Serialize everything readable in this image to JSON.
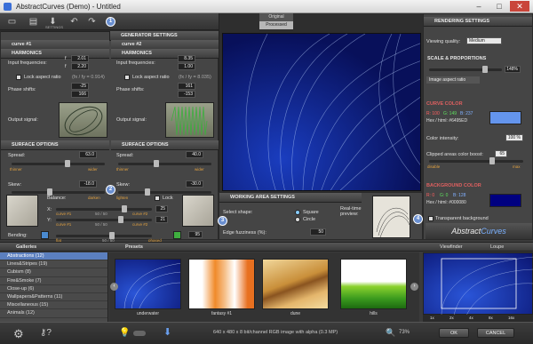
{
  "window": {
    "title": "AbstractCurves (Demo) - Untitled"
  },
  "toolbar": {
    "settings_label": "SETTINGS"
  },
  "generator": {
    "title": "GENERATOR SETTINGS",
    "curve1": "curve #1",
    "curve2": "curve #2",
    "harmonics": "HARMONICS",
    "input_freq": "Input frequencies:",
    "fx": "f",
    "fy": "f",
    "c1_fx": "2.01",
    "c1_fy": "2.20",
    "c2_fx": "8.35",
    "c2_fy": "1.00",
    "lock_aspect": "Lock aspect ratio",
    "c1_ratio": "(fx / fy = 0.914)",
    "c2_ratio": "(fx / fy = 8.035)",
    "phase_shifts": "Phase shifts:",
    "c1_px": "-25",
    "c1_py": "166",
    "c2_px": "161",
    "c2_py": "-153",
    "output_signal": "Output signal:",
    "surface": "SURFACE OPTIONS",
    "spread": "Spread:",
    "skew": "Skew:",
    "c1_spread": "63.0",
    "c1_skew": "-18.0",
    "c2_spread": "40.0",
    "c2_skew": "-30.0",
    "thinner": "thinner",
    "wider": "wider",
    "lighten": "lighten",
    "darken": "darken",
    "balance": "Balance:",
    "lock": "Lock",
    "x": "X:",
    "y": "Y:",
    "half": "50 / 50",
    "bal_x": "25",
    "bal_y": "21",
    "bending": "Bending:",
    "flat": "flat",
    "phased": "phased",
    "bend_val": "95"
  },
  "preview": {
    "original": "Original",
    "processed": "Processed"
  },
  "working_area": {
    "title": "WORKING AREA SETTINGS",
    "select_shape": "Select shape:",
    "square": "Square",
    "circle": "Circle",
    "edge": "Edge fuzziness (%):",
    "edge_val": "50",
    "realtime": "Real-time preview:"
  },
  "rendering": {
    "title": "RENDERING SETTINGS",
    "quality_label": "Viewing quality:",
    "quality_val": "Medium",
    "scale": "SCALE & PROPORTIONS",
    "scale_val": "148%",
    "aspect": "Image aspect ratio",
    "curve_color": "CURVE COLOR",
    "curve_r": "R: 100",
    "curve_g": "G: 149",
    "curve_b": "B: 237",
    "curve_hex": "Hex / html: #6495ED",
    "curve_color_hex": "#6495ED",
    "intensity": "Color intensity:",
    "intensity_val": "100 %",
    "clipped": "Clipped areas color boost:",
    "clipped_val": "65",
    "disable": "disable",
    "max": "max",
    "bg_color": "BACKGROUND COLOR",
    "bg_r": "R: 0",
    "bg_g": "G: 0",
    "bg_b": "B: 128",
    "bg_hex": "Hex / html: #000080",
    "bg_color_hex": "#000080",
    "transparent": "Transparent background",
    "logo_a": "Abstract",
    "logo_b": "Curves"
  },
  "galleries": {
    "title": "Galleries",
    "presets": "Presets",
    "categories": [
      "Abstractions (12)",
      "Lines&Stripes (19)",
      "Cubism (8)",
      "Fire&Smoke (7)",
      "Close-up (6)",
      "Wallpapers&Patterns (11)",
      "Miscellaneous (15)",
      "Animals (12)"
    ],
    "thumbs": [
      "underwater",
      "fantasy #1",
      "dune",
      "hills"
    ]
  },
  "viewfinder": {
    "title": "Viewfinder",
    "loupe": "Loupe",
    "zooms": [
      "1x",
      "2x",
      "4x",
      "8x",
      "16x"
    ]
  },
  "status": {
    "info": "640 x 480 x 8 bit/channel RGB image with alpha  (0.3 MP)",
    "zoom": "73%",
    "ok": "OK",
    "cancel": "CANCEL"
  },
  "badges": [
    "1",
    "2",
    "3",
    "4"
  ]
}
